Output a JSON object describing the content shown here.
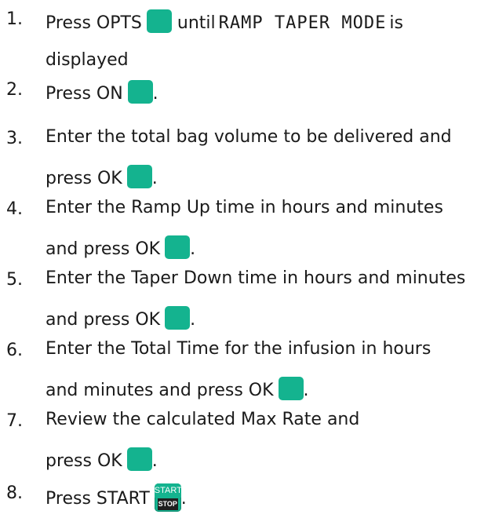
{
  "steps": [
    {
      "num": "1.",
      "line1_pre": "Press OPTS",
      "line1_mid": "until",
      "mode": "RAMP TAPER MODE",
      "line1_post": "is",
      "line2": "displayed"
    },
    {
      "num": "2.",
      "line1": "Press ON",
      "after": "."
    },
    {
      "num": "3.",
      "line1": "Enter the total bag volume to be delivered and",
      "line2": "press OK",
      "after": "."
    },
    {
      "num": "4.",
      "line1": "Enter the Ramp Up time in hours and minutes",
      "line2": "and press OK",
      "after": "."
    },
    {
      "num": "5.",
      "line1": "Enter the Taper Down time in hours and minutes",
      "line2": "and press OK",
      "after": "."
    },
    {
      "num": "6.",
      "line1": "Enter the Total Time for the infusion in hours",
      "line2": "and minutes and press OK",
      "after": "."
    },
    {
      "num": "7.",
      "line1": "Review the calculated Max Rate and",
      "line2": "press OK",
      "after": "."
    },
    {
      "num": "8.",
      "line1": "Press START",
      "after": "."
    }
  ],
  "start_stop_key": {
    "top": "START",
    "bottom": "STOP"
  },
  "colors": {
    "key": "#14b38f",
    "stop_band": "#1f1f1f"
  }
}
